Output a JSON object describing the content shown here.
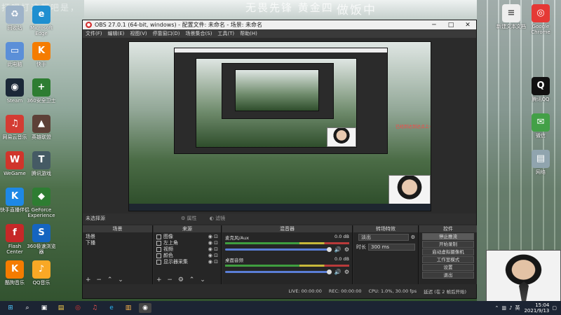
{
  "overlay": {
    "left_text": "打吧打这都吧是，",
    "center_text": "无畏先锋 黄金四",
    "right_text": "做饭中"
  },
  "desktop_icons_left": [
    {
      "name": "recycle-bin",
      "label": "回收站",
      "color": "#9eb3c9",
      "glyph": "♻"
    },
    {
      "name": "this-pc",
      "label": "此电脑",
      "color": "#5b8fd8",
      "glyph": "▭"
    },
    {
      "name": "steam",
      "label": "Steam",
      "color": "#1b2838",
      "glyph": "◉"
    },
    {
      "name": "netease-cloud-music",
      "label": "网易云音乐",
      "color": "#d43c33",
      "glyph": "♫"
    },
    {
      "name": "wegame",
      "label": "WeGame",
      "color": "#d0352b",
      "glyph": "W"
    },
    {
      "name": "kuaishou",
      "label": "快手直播伴侣",
      "color": "#1e88e5",
      "glyph": "K"
    },
    {
      "name": "flash",
      "label": "Flash Center",
      "color": "#c62828",
      "glyph": "f"
    },
    {
      "name": "kugou",
      "label": "酷狗音乐",
      "color": "#f57c00",
      "glyph": "K"
    }
  ],
  "desktop_icons_left2": [
    {
      "name": "edge",
      "label": "Microsoft Edge",
      "color": "#1f8fd0",
      "glyph": "e"
    },
    {
      "name": "kuaishou-app",
      "label": "快手",
      "color": "#f57c00",
      "glyph": "K"
    },
    {
      "name": "360-safe",
      "label": "360安全卫士",
      "color": "#2e7d32",
      "glyph": "+"
    },
    {
      "name": "game-app",
      "label": "英雄联盟",
      "color": "#5d4037",
      "glyph": "▲"
    },
    {
      "name": "tencent-game",
      "label": "腾讯游戏",
      "color": "#455a64",
      "glyph": "T"
    },
    {
      "name": "geforce",
      "label": "GeForce Experience",
      "color": "#2e7d32",
      "glyph": "◆"
    },
    {
      "name": "browser-360",
      "label": "360极速浏览器",
      "color": "#1565c0",
      "glyph": "S"
    },
    {
      "name": "qq-music",
      "label": "QQ音乐",
      "color": "#f9a825",
      "glyph": "♪"
    }
  ],
  "desktop_icons_right": [
    {
      "name": "new-text-doc",
      "label": "新建文本文档",
      "color": "#eeeeee",
      "glyph": "≡"
    },
    {
      "name": "google-chrome",
      "label": "Google Chrome",
      "color": "#e53935",
      "glyph": "◎"
    },
    {
      "name": "tencent-qq",
      "label": "腾讯QQ",
      "color": "#111111",
      "glyph": "Q"
    },
    {
      "name": "wechat",
      "label": "微信",
      "color": "#43a047",
      "glyph": "✉"
    },
    {
      "name": "network-folder",
      "label": "网络",
      "color": "#90a4ae",
      "glyph": "▤"
    }
  ],
  "obs": {
    "title": "OBS 27.0.1 (64-bit, windows) - 配置文件: 未命名 - 场景: 未命名",
    "menu": [
      "文件(F)",
      "编辑(E)",
      "视图(V)",
      "停靠窗口(D)",
      "场景集合(S)",
      "工具(T)",
      "帮助(H)"
    ],
    "no_source_selected": "未选择源",
    "tab_properties": "属性",
    "tab_filters": "滤镜",
    "preview_alert": "已经到达到达点上一点进入直播",
    "scenes": {
      "header": "场景",
      "items": [
        "场景",
        "下播"
      ]
    },
    "sources": {
      "header": "来源",
      "items": [
        "图像",
        "左上角",
        "视频",
        "颜色",
        "显示器采集"
      ]
    },
    "mixer": {
      "header": "混音器",
      "channels": [
        {
          "name": "麦克风/Aux",
          "db": "0.0 dB"
        },
        {
          "name": "桌面音频",
          "db": "0.0 dB"
        }
      ]
    },
    "transitions": {
      "header": "转场特效",
      "type": "淡出",
      "duration_label": "时长",
      "duration_value": "300 ms"
    },
    "controls": {
      "header": "控件",
      "buttons": [
        "停止推流",
        "开始录制",
        "启动虚拟摄像机",
        "工作室模式",
        "设置",
        "退出"
      ]
    },
    "status": {
      "live": "LIVE: 00:00:00",
      "rec": "REC: 00:00:00",
      "cpu": "CPU: 1.0%, 30.00 fps",
      "dropped": "延迟 (在 2 帧后开始)"
    }
  },
  "taskbar": {
    "time": "15:04",
    "date": "2021/9/13",
    "ime": "英",
    "apps": [
      "search",
      "task-view",
      "file-explorer",
      "chrome",
      "netease",
      "edge",
      "folder",
      "obs"
    ]
  }
}
